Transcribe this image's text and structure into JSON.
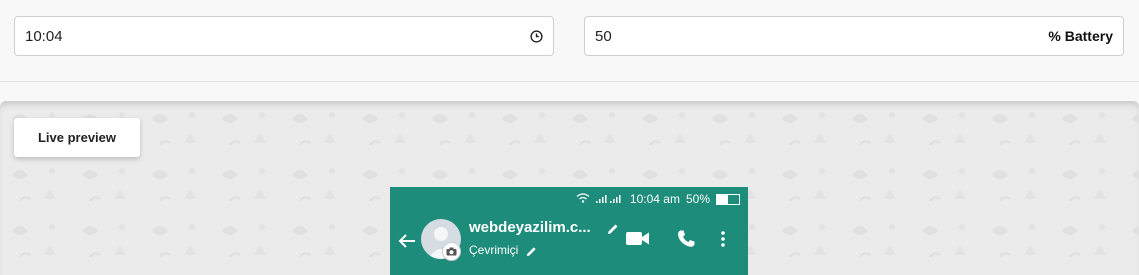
{
  "form": {
    "time_value": "10:04",
    "battery_value": "50",
    "battery_suffix": "% Battery"
  },
  "preview": {
    "live_button_label": "Live preview"
  },
  "phone": {
    "status_time": "10:04 am",
    "battery_percent_text": "50%",
    "battery_level": 0.5,
    "contact_name": "webdeyazilim.c...",
    "contact_status": "Çevrimiçi",
    "header_color": "#1e8c7a"
  },
  "icons": [
    "clock-icon",
    "wifi-icon",
    "signal-icon",
    "battery-icon",
    "back-arrow-icon",
    "avatar",
    "camera-icon",
    "edit-icon",
    "video-call-icon",
    "phone-call-icon",
    "more-vert-icon"
  ]
}
